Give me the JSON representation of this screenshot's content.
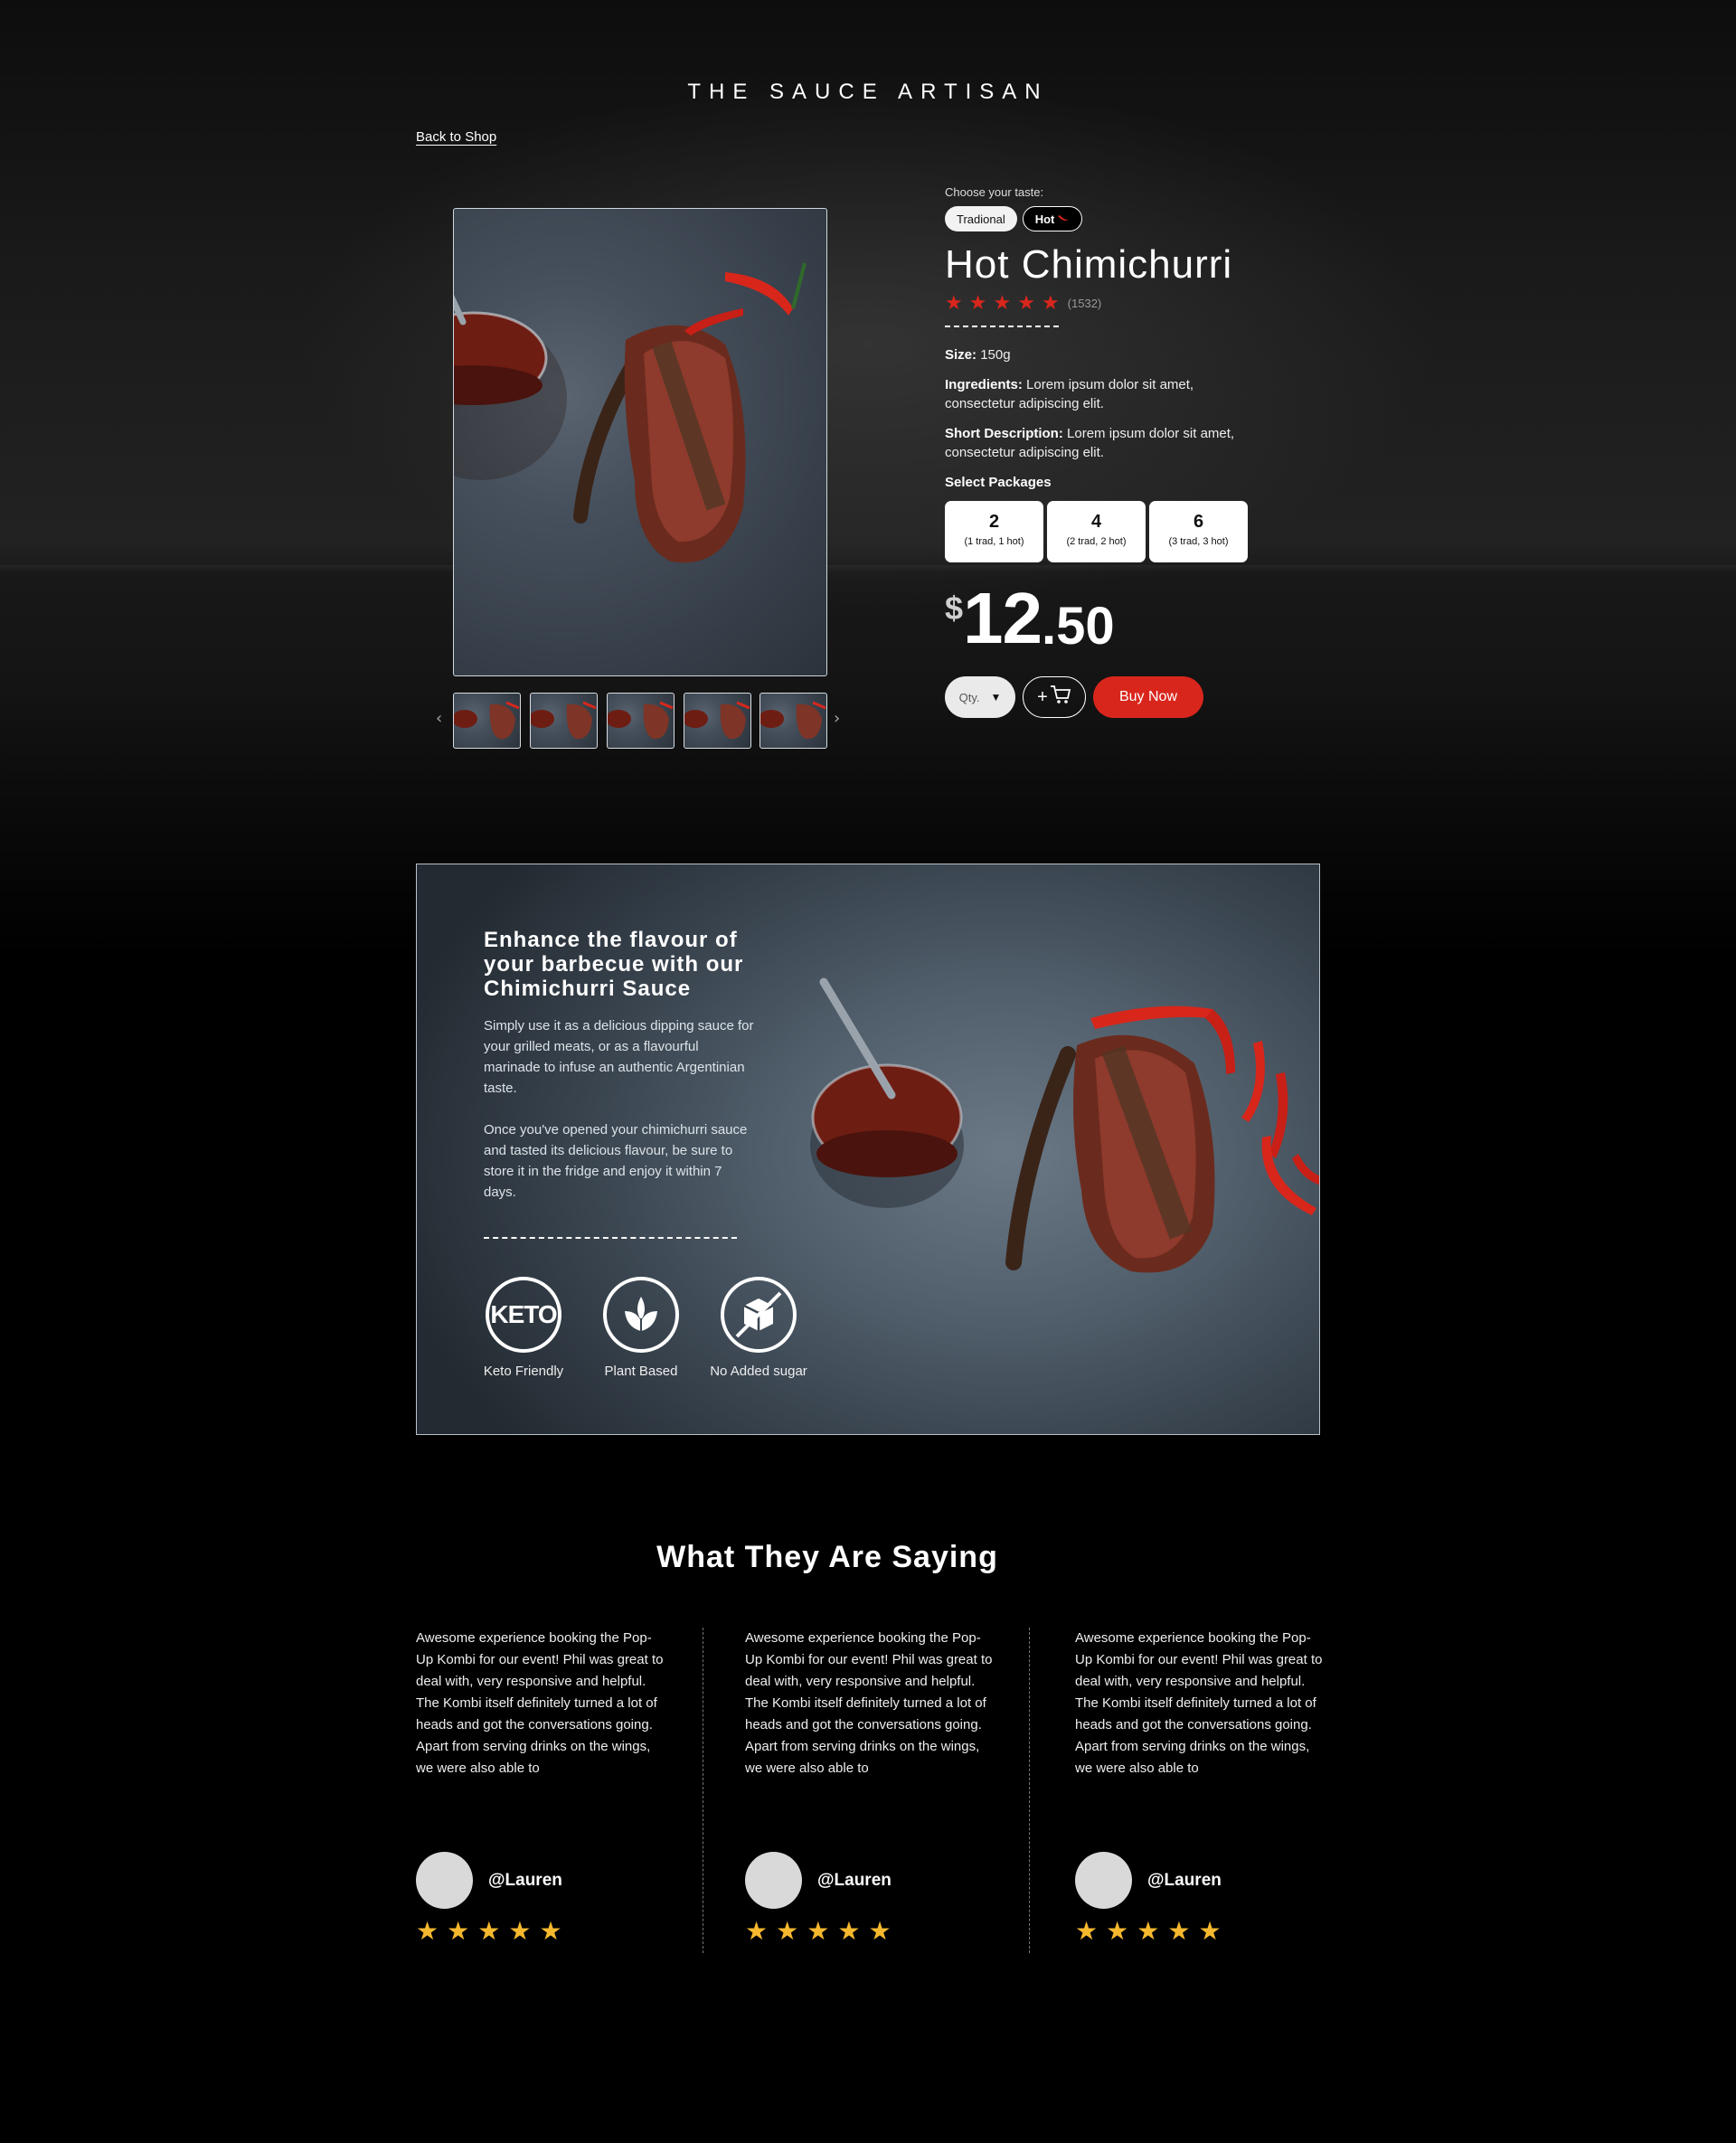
{
  "brand": "THE SAUCE ARTISAN",
  "nav": {
    "back_label": "Back to Shop"
  },
  "product": {
    "taste_label": "Choose your taste:",
    "tastes": [
      "Tradional",
      "Hot"
    ],
    "title": "Hot Chimichurri",
    "rating": 5,
    "review_count": "(1532)",
    "size_label": "Size:",
    "size_value": "150g",
    "ingredients_label": "Ingredients:",
    "ingredients_value": "Lorem ipsum dolor sit amet, consectetur adipiscing elit.",
    "short_desc_label": "Short Description:",
    "short_desc_value": "Lorem ipsum dolor sit amet, consectetur adipiscing elit.",
    "packages_label": "Select Packages",
    "packages": [
      {
        "count": "2",
        "detail": "(1 trad, 1 hot)"
      },
      {
        "count": "4",
        "detail": "(2 trad, 2 hot)"
      },
      {
        "count": "6",
        "detail": "(3 trad, 3 hot)"
      }
    ],
    "price": {
      "currency": "$",
      "whole": "12",
      "decimal": ".50"
    },
    "qty_label": "Qty.",
    "cart_label": "+",
    "buy_label": "Buy Now"
  },
  "feature": {
    "title": "Enhance the flavour of your barbecue with our Chimichurri Sauce",
    "para1": "Simply use it as a delicious dipping sauce for your grilled meats, or as a flavourful marinade to infuse an authentic Argentinian taste.",
    "para2": "Once you've opened your chimichurri sauce and tasted its delicious flavour, be sure to store it in the fridge and enjoy it within 7 days.",
    "badges": [
      {
        "icon": "keto-icon",
        "text": "KETO",
        "label": "Keto Friendly"
      },
      {
        "icon": "leaf-icon",
        "label": "Plant Based"
      },
      {
        "icon": "no-sugar-icon",
        "label": "No Added sugar"
      }
    ]
  },
  "reviews": {
    "title": "What They Are Saying",
    "items": [
      {
        "text": "Awesome experience booking the Pop-Up Kombi for our event! Phil was great to deal with, very responsive and helpful. The Kombi itself definitely turned a lot of heads and got the conversations going. Apart from serving drinks on the wings, we were also able to",
        "handle": "@Lauren",
        "stars": 5
      },
      {
        "text": "Awesome experience booking the Pop-Up Kombi for our event! Phil was great to deal with, very responsive and helpful. The Kombi itself definitely turned a lot of heads and got the conversations going. Apart from serving drinks on the wings, we were also able to",
        "handle": "@Lauren",
        "stars": 5
      },
      {
        "text": "Awesome experience booking the Pop-Up Kombi for our event! Phil was great to deal with, very responsive and helpful. The Kombi itself definitely turned a lot of heads and got the conversations going. Apart from serving drinks on the wings, we were also able to",
        "handle": "@Lauren",
        "stars": 5
      }
    ]
  },
  "colors": {
    "accent": "#d9261c",
    "star_gold": "#f5b82e",
    "background": "#000000"
  }
}
